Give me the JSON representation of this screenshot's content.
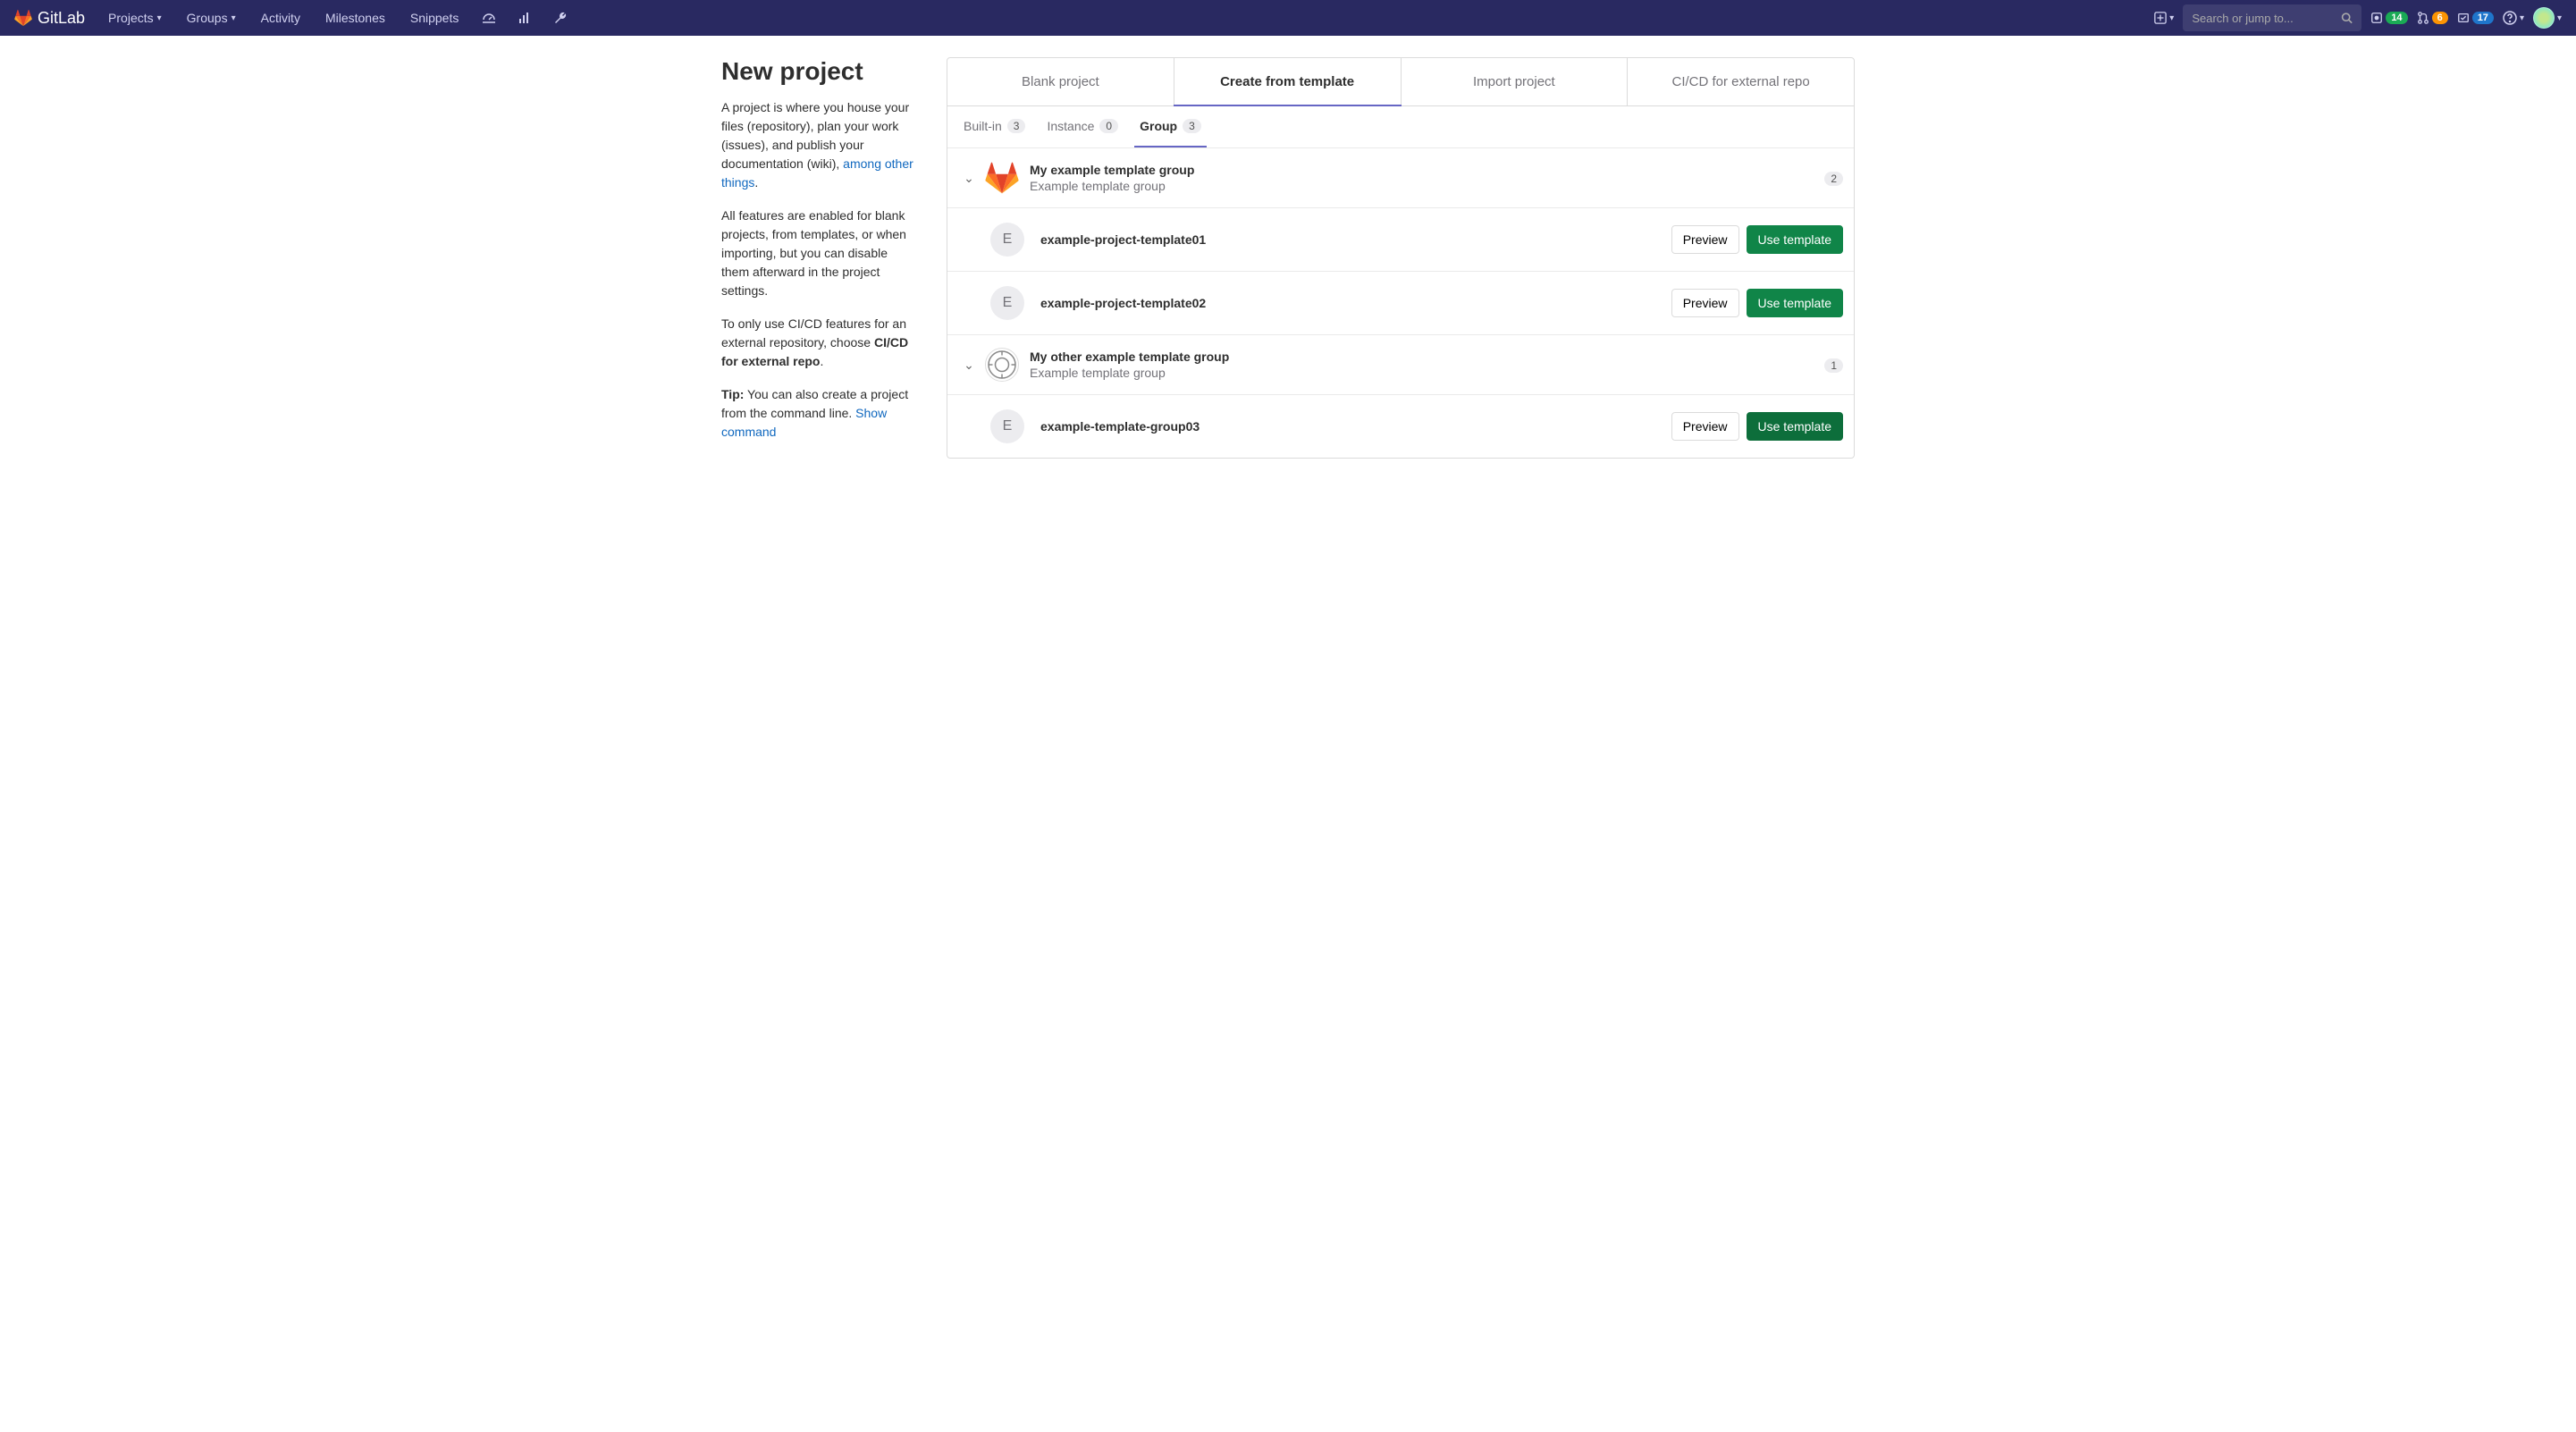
{
  "navbar": {
    "brand": "GitLab",
    "items": {
      "projects": "Projects",
      "groups": "Groups",
      "activity": "Activity",
      "milestones": "Milestones",
      "snippets": "Snippets"
    },
    "search_placeholder": "Search or jump to...",
    "badges": {
      "issues": "14",
      "merge_requests": "6",
      "todos": "17"
    }
  },
  "sidebar": {
    "title": "New project",
    "p1_a": "A project is where you house your files (repository), plan your work (issues), and publish your documentation (wiki), ",
    "p1_link": "among other things",
    "p1_b": ".",
    "p2": "All features are enabled for blank projects, from templates, or when importing, but you can disable them afterward in the project settings.",
    "p3_a": "To only use CI/CD features for an external repository, choose ",
    "p3_bold": "CI/CD for external repo",
    "p3_b": ".",
    "p4_tip": "Tip:",
    "p4_a": " You can also create a project from the command line. ",
    "p4_link": "Show command"
  },
  "main_tabs": {
    "blank": "Blank project",
    "template": "Create from template",
    "import": "Import project",
    "cicd": "CI/CD for external repo"
  },
  "sub_tabs": {
    "builtin": {
      "label": "Built-in",
      "count": "3"
    },
    "instance": {
      "label": "Instance",
      "count": "0"
    },
    "group": {
      "label": "Group",
      "count": "3"
    }
  },
  "groups": [
    {
      "name": "My example template group",
      "desc": "Example template group",
      "count": "2",
      "icon": "tanuki",
      "templates": [
        {
          "letter": "E",
          "name": "example-project-template01"
        },
        {
          "letter": "E",
          "name": "example-project-template02"
        }
      ]
    },
    {
      "name": "My other example template group",
      "desc": "Example template group",
      "count": "1",
      "icon": "circle",
      "templates": [
        {
          "letter": "E",
          "name": "example-template-group03"
        }
      ]
    }
  ],
  "labels": {
    "preview": "Preview",
    "use_template": "Use template"
  }
}
